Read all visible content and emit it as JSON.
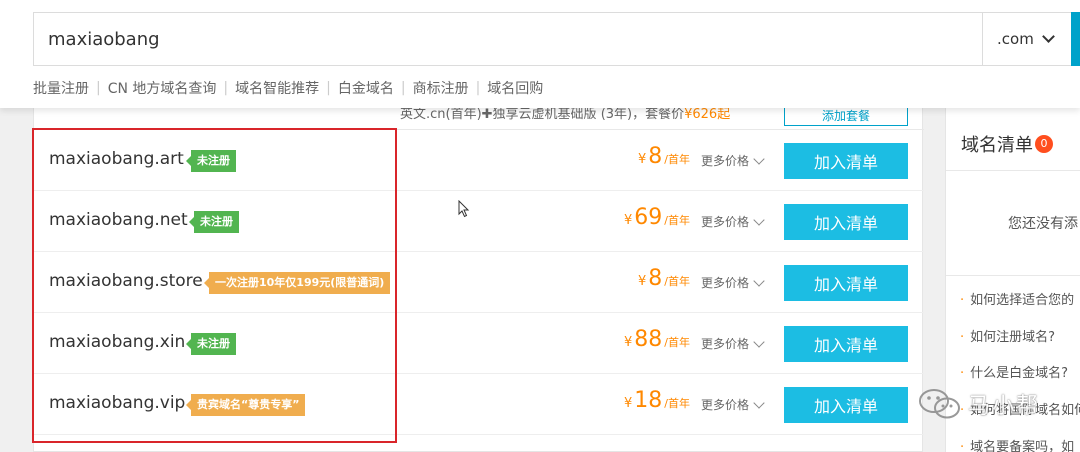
{
  "search": {
    "query": "maxiaobang",
    "suffix": ".com"
  },
  "quick_links": [
    "批量注册",
    "CN 地方域名查询",
    "域名智能推荐",
    "白金域名",
    "商标注册",
    "域名回购"
  ],
  "promo": {
    "text": "英文.cn(首年)✚独享云虚机基础版 (3年)，套餐价",
    "price": "¥626起",
    "button": "添加套餐"
  },
  "results": [
    {
      "domain": "maxiaobang.art",
      "badge": "未注册",
      "badge_color": "#52b550",
      "currency": "¥",
      "price": "8",
      "unit": "/首年",
      "more": "更多价格",
      "button": "加入清单"
    },
    {
      "domain": "maxiaobang.net",
      "badge": "未注册",
      "badge_color": "#52b550",
      "currency": "¥",
      "price": "69",
      "unit": "/首年",
      "more": "更多价格",
      "button": "加入清单"
    },
    {
      "domain": "maxiaobang.store",
      "badge": "一次注册10年仅199元(限普通词)",
      "badge_color": "#f0ad4e",
      "currency": "¥",
      "price": "8",
      "unit": "/首年",
      "more": "更多价格",
      "button": "加入清单"
    },
    {
      "domain": "maxiaobang.xin",
      "badge": "未注册",
      "badge_color": "#52b550",
      "currency": "¥",
      "price": "88",
      "unit": "/首年",
      "more": "更多价格",
      "button": "加入清单"
    },
    {
      "domain": "maxiaobang.vip",
      "badge": "贵宾域名“尊贵专享”",
      "badge_color": "#f0ad4e",
      "currency": "¥",
      "price": "18",
      "unit": "/首年",
      "more": "更多价格",
      "button": "加入清单"
    }
  ],
  "sidebar": {
    "title": "域名清单",
    "count": "0",
    "empty_text": "您还没有添",
    "faq": [
      "如何选择适合您的",
      "如何注册域名?",
      "什么是白金域名?",
      "如何将国际域名如何",
      "域名要备案吗，如"
    ]
  },
  "watermark": {
    "text": "马小帮"
  },
  "colors": {
    "accent": "#1cbde3",
    "price": "#ff8800",
    "badge_green": "#52b550",
    "badge_orange": "#f0ad4e",
    "highlight_border": "#d9252a"
  }
}
